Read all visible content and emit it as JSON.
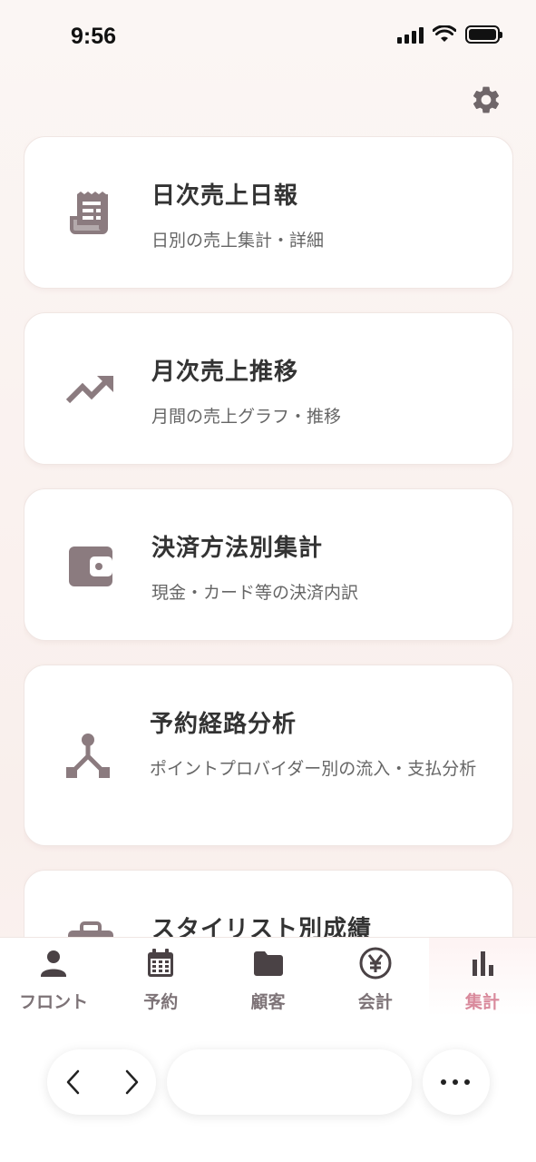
{
  "status_bar": {
    "time": "9:56"
  },
  "theme": {
    "icon_color": "#8b7b7f",
    "accent": "#d98a9c",
    "label_color": "#7d7377"
  },
  "cards": [
    {
      "title": "日次売上日報",
      "description": "日別の売上集計・詳細",
      "icon": "receipt-icon"
    },
    {
      "title": "月次売上推移",
      "description": "月間の売上グラフ・推移",
      "icon": "trending-up-icon"
    },
    {
      "title": "決済方法別集計",
      "description": "現金・カード等の決済内訳",
      "icon": "wallet-icon"
    },
    {
      "title": "予約経路分析",
      "description": "ポイントプロバイダー別の流入・支払分析",
      "icon": "route-split-icon"
    },
    {
      "title": "スタイリスト別成績",
      "description": "",
      "icon": "briefcase-icon"
    }
  ],
  "bottom_nav": [
    {
      "label": "フロント",
      "icon": "person-icon",
      "active": false
    },
    {
      "label": "予約",
      "icon": "calendar-icon",
      "active": false
    },
    {
      "label": "顧客",
      "icon": "folder-icon",
      "active": false
    },
    {
      "label": "会計",
      "icon": "yen-icon",
      "active": false
    },
    {
      "label": "集計",
      "icon": "bar-chart-icon",
      "active": true
    }
  ],
  "browser_toolbar": {
    "back_icon": "chevron-left-icon",
    "forward_icon": "chevron-right-icon",
    "more_icon": "more-dots-icon"
  }
}
